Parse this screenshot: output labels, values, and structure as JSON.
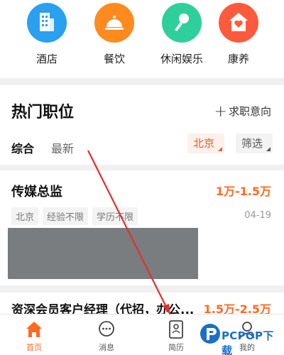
{
  "categories": [
    {
      "label": "酒店",
      "icon": "building-icon",
      "color": "#2aa0f0"
    },
    {
      "label": "餐饮",
      "icon": "dish-cover-icon",
      "color": "#ff8a1e"
    },
    {
      "label": "休闲娱乐",
      "icon": "microphone-icon",
      "color": "#2ecf9a"
    },
    {
      "label": "康养",
      "icon": "heart-house-icon",
      "color": "#ff5a3c"
    }
  ],
  "section": {
    "title": "热门职位",
    "intent_plus": "+",
    "intent_label": "求职意向",
    "tabs": [
      "综合",
      "最新"
    ],
    "filter_city": "北京",
    "filter_select": "筛选"
  },
  "jobs": [
    {
      "title": "传媒总监",
      "salary": "1万-1.5万",
      "tags": [
        "北京",
        "经验不限",
        "学历不限"
      ],
      "date": "04-19"
    },
    {
      "title": "资深会员客户经理（代招，办公...",
      "salary": "1.5万-2.5万"
    }
  ],
  "nav": [
    {
      "label": "首页",
      "icon": "home-icon",
      "active": true
    },
    {
      "label": "消息",
      "icon": "chat-icon",
      "active": false
    },
    {
      "label": "简历",
      "icon": "resume-icon",
      "active": false
    },
    {
      "label": "我的",
      "icon": "profile-icon",
      "active": false
    }
  ],
  "watermark": {
    "text": "PCPOP下载"
  },
  "colors": {
    "accent": "#ff6a20",
    "arrow": "#e0302a",
    "watermark": "#1a6fc9"
  }
}
